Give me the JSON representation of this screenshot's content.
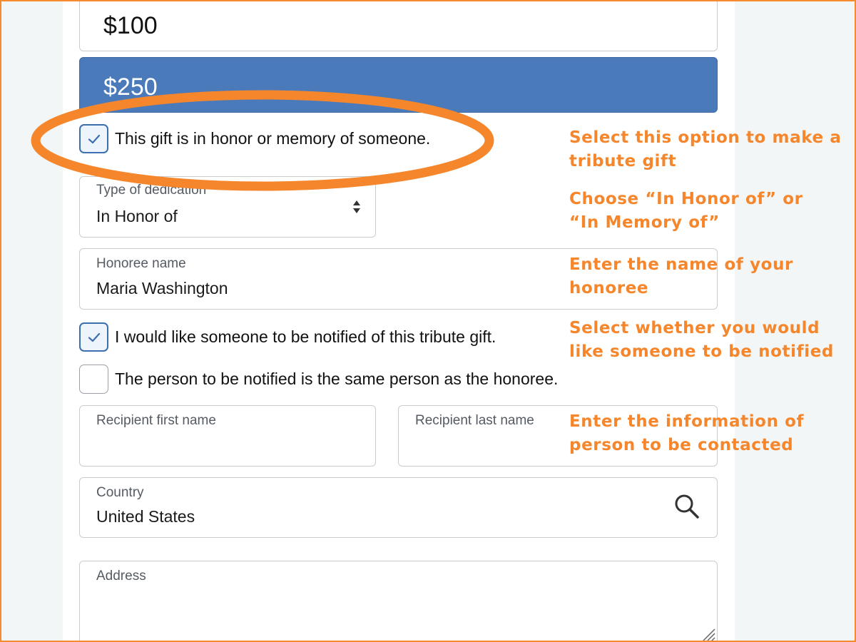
{
  "amounts": [
    {
      "label": "$100",
      "selected": false
    },
    {
      "label": "$250",
      "selected": true
    }
  ],
  "tribute": {
    "label": "This gift is in honor or memory of someone.",
    "checked": true
  },
  "dedication": {
    "label": "Type of dedication",
    "value": "In Honor of"
  },
  "honoree": {
    "label": "Honoree name",
    "value": "Maria Washington"
  },
  "notify": {
    "label": "I would like someone to be notified of this tribute gift.",
    "checked": true
  },
  "same_person": {
    "label": "The person to be notified is the same person as the honoree.",
    "checked": false
  },
  "recipient_first": {
    "label": "Recipient first name",
    "value": ""
  },
  "recipient_last": {
    "label": "Recipient last name",
    "value": ""
  },
  "country": {
    "label": "Country",
    "value": "United States"
  },
  "address": {
    "label": "Address",
    "value": ""
  },
  "annotations": [
    "Select this option to make a\ntribute gift",
    "Choose “In Honor of” or\n“In Memory of”",
    "Enter the name of your\nhonoree",
    "Select whether you would\nlike someone to be notified",
    "Enter the information of\nperson to be contacted"
  ],
  "colors": {
    "accent": "#f5862b",
    "selected_amount": "#4a7aba",
    "checkbox_border": "#3c6fae"
  },
  "icons": [
    "check-icon",
    "select-arrows-icon",
    "search-icon",
    "resize-grip-icon"
  ]
}
